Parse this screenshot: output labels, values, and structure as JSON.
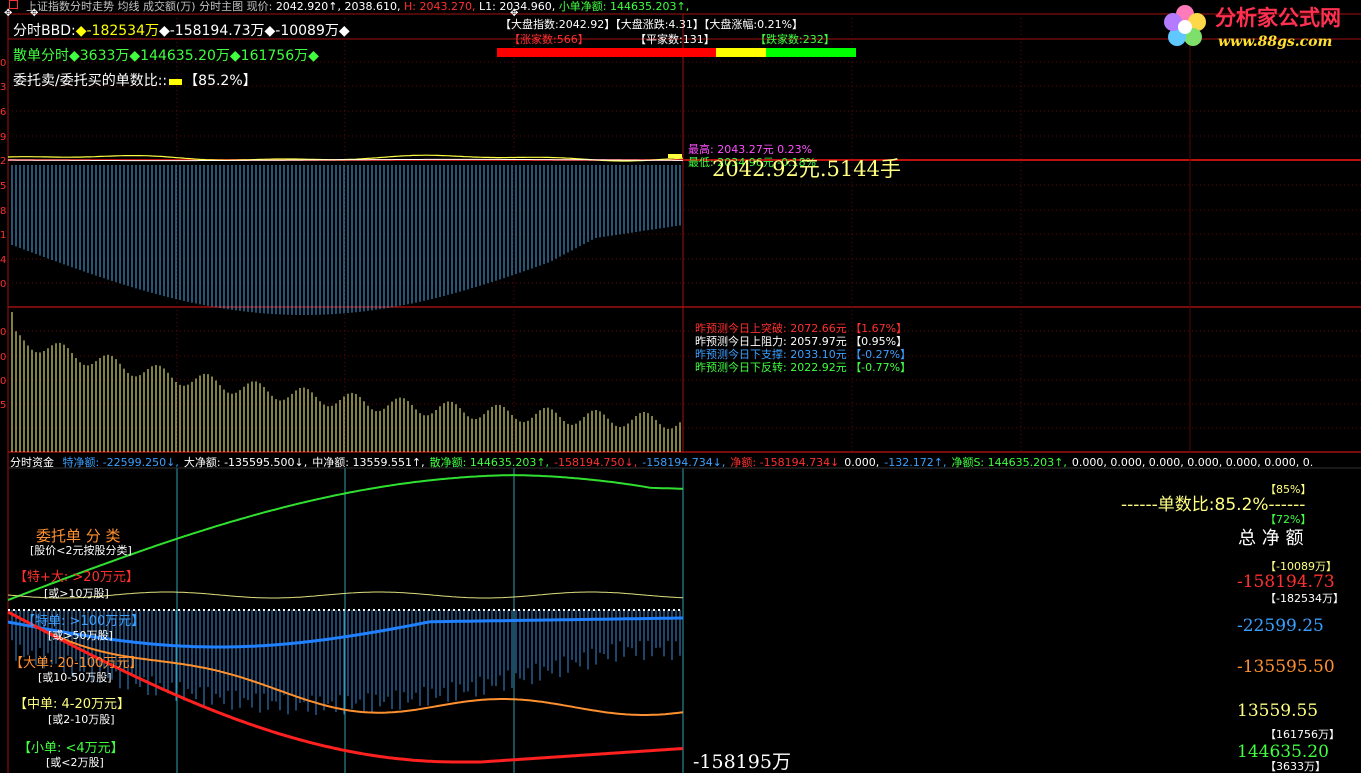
{
  "header": {
    "title": "上证指数分时走势",
    "ma_label": "均线",
    "volume_label": "成交额(万)",
    "main_label": "分时主图",
    "price_label": "现价:",
    "price_value": "2042.920↑,",
    "prev_value": "2038.610,",
    "high_label": "H:",
    "high_value": "2043.270,",
    "low_label": "L1:",
    "low_value": "2034.960,",
    "small_net_label": "小单净额:",
    "small_net_value": "144635.203↑,"
  },
  "market_summary": {
    "index": "【大盘指数:2042.92】",
    "change": "【大盘涨跌:4.31】",
    "change_pct": "【大盘涨幅:0.21%】",
    "up_count": "【涨家数:566】",
    "flat_count": "【平家数:131】",
    "down_count": "【跌家数:232】",
    "colors": {
      "up": "#ff0000",
      "flat": "#ffff00",
      "down": "#00ff00"
    },
    "breadth_values": {
      "up": 566,
      "flat": 131,
      "down": 232
    }
  },
  "logo": {
    "main": "分析家公式网",
    "url": "www.88gs.com"
  },
  "panel_top": {
    "bbd_label": "分时BBD:",
    "bbd_v1": "◆-182534万",
    "bbd_v2": "◆-158194.73万",
    "bbd_v3": "◆-10089万◆",
    "retail_label": "散单分时",
    "retail_v1": "◆3633万",
    "retail_v2": "◆144635.20万",
    "retail_v3": "◆161756万◆",
    "ratio_label": "委托卖/委托买的单数比::",
    "ratio_value": "【85.2%】",
    "high_tag": "最高: 2043.27元  0.23%",
    "low_tag": "最低: 2034.96元  -0.18%",
    "big_price": "2042.92元.5144手"
  },
  "predictions": [
    {
      "label": "昨预测今日上突破:",
      "value": "2072.66元",
      "pct": "【1.67%】",
      "color": "#ff3030"
    },
    {
      "label": "昨预测今日上阻力:",
      "value": "2057.97元",
      "pct": "【0.95%】",
      "color": "#ffffff"
    },
    {
      "label": "昨预测今日下支撑:",
      "value": "2033.10元",
      "pct": "【-0.27%】",
      "color": "#3aa0ff"
    },
    {
      "label": "昨预测今日下反转:",
      "value": "2022.92元",
      "pct": "【-0.77%】",
      "color": "#40ff40"
    }
  ],
  "flow_bar": {
    "title": "分时资金",
    "items": [
      {
        "text": "特净额: -22599.250↓,",
        "color": "#3aa0ff"
      },
      {
        "text": "大净额: -135595.500↓,",
        "color": "#ffffff"
      },
      {
        "text": "中净额: 13559.551↑,",
        "color": "#ffffff"
      },
      {
        "text": "散净额: 144635.203↑,",
        "color": "#40ff40"
      },
      {
        "text": "-158194.750↓,",
        "color": "#ff3030"
      },
      {
        "text": "-158194.734↓,",
        "color": "#3aa0ff"
      },
      {
        "text": "净额: -158194.734↓",
        "color": "#ff3030"
      },
      {
        "text": "0.000,",
        "color": "#ffffff"
      },
      {
        "text": "-132.172↑,",
        "color": "#3aa0ff"
      },
      {
        "text": "净额S: 144635.203↑,",
        "color": "#40ff40"
      },
      {
        "text": "0.000, 0.000, 0.000, 0.000, 0.000, 0.000, 0.",
        "color": "#ffffff"
      }
    ]
  },
  "legend": {
    "title": "委托单 分 类",
    "subtitle": "[股价<2元按股分类]",
    "super": "【特+大: >20万元】",
    "super_note": "[或>10万股]",
    "special": "【特单: >100万元】",
    "special_note": "[或>50万股]",
    "large": "【大单: 20-100万元】",
    "large_note": "[或10-50万股]",
    "medium": "【中单: 4-20万元】",
    "medium_note": "[或2-10万股]",
    "small": "【小单: <4万元】",
    "small_note": "[或<2万股]"
  },
  "right_panel": {
    "pct85": "【85%】",
    "ratio_line": "------单数比:85.2%------",
    "pct72": "【72%】",
    "total_net": "总 净 额",
    "tag1": "【-10089万】",
    "val1": "-158194.73",
    "tag2": "【-182534万】",
    "val2": "-22599.25",
    "val3": "-135595.50",
    "val4": "13559.55",
    "tag3": "【161756万】",
    "val5": "144635.20",
    "tag4": "【3633万】"
  },
  "bottom_big": "-158195万",
  "left_axis": [
    "0",
    "3",
    "6",
    "9",
    "2",
    "5",
    "8",
    "1",
    "4",
    "0",
    "0",
    "0",
    "0",
    "5"
  ]
}
